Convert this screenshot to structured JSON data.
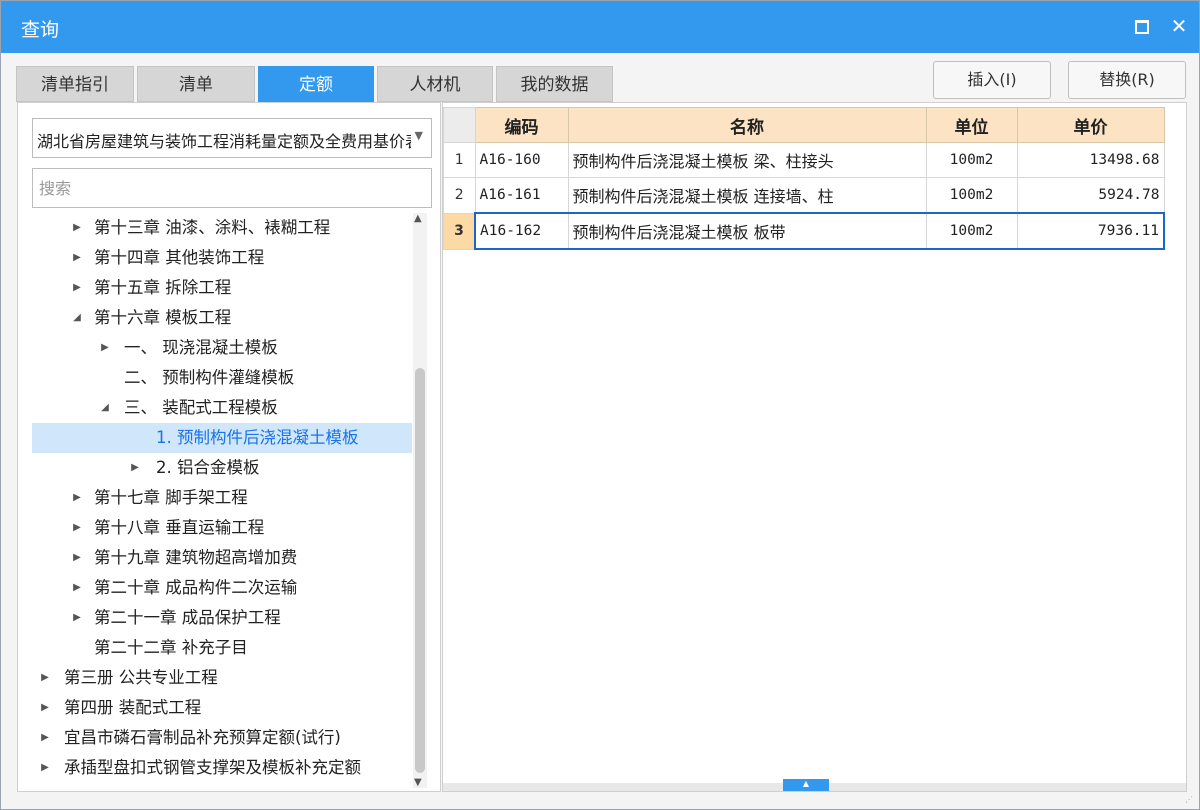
{
  "window": {
    "title": "查询",
    "maximize_icon": "maximize-icon",
    "close_label": "✕"
  },
  "tabs": [
    {
      "label": "清单指引",
      "active": false
    },
    {
      "label": "清单",
      "active": false
    },
    {
      "label": "定额",
      "active": true
    },
    {
      "label": "人材机",
      "active": false
    },
    {
      "label": "我的数据",
      "active": false
    }
  ],
  "actions": {
    "insert_label": "插入(I)",
    "replace_label": "替换(R)"
  },
  "left": {
    "selector_value": "湖北省房屋建筑与装饰工程消耗量定额及全费用基价表",
    "search_placeholder": "搜索",
    "tree": [
      {
        "label": "第十三章 油漆、涂料、裱糊工程",
        "arrow": "▶"
      },
      {
        "label": "第十四章 其他装饰工程",
        "arrow": "▶"
      },
      {
        "label": "第十五章 拆除工程",
        "arrow": "▶"
      },
      {
        "label": "第十六章 模板工程",
        "arrow": "◢"
      },
      {
        "label": "一、 现浇混凝土模板",
        "arrow": "▶"
      },
      {
        "label": "二、 预制构件灌缝模板",
        "arrow": ""
      },
      {
        "label": "三、 装配式工程模板",
        "arrow": "◢"
      },
      {
        "label": "1. 预制构件后浇混凝土模板",
        "arrow": "",
        "selected": true
      },
      {
        "label": "2. 铝合金模板",
        "arrow": "▶"
      },
      {
        "label": "第十七章 脚手架工程",
        "arrow": "▶"
      },
      {
        "label": "第十八章 垂直运输工程",
        "arrow": "▶"
      },
      {
        "label": "第十九章 建筑物超高增加费",
        "arrow": "▶"
      },
      {
        "label": "第二十章 成品构件二次运输",
        "arrow": "▶"
      },
      {
        "label": "第二十一章 成品保护工程",
        "arrow": "▶"
      },
      {
        "label": "第二十二章 补充子目",
        "arrow": ""
      },
      {
        "label": "第三册 公共专业工程",
        "arrow": "▶"
      },
      {
        "label": "第四册 装配式工程",
        "arrow": "▶"
      },
      {
        "label": "宜昌市磷石膏制品补充预算定额(试行)",
        "arrow": "▶"
      },
      {
        "label": "承插型盘扣式钢管支撑架及模板补充定额",
        "arrow": "▶"
      }
    ]
  },
  "table": {
    "headers": {
      "code": "编码",
      "name": "名称",
      "unit": "单位",
      "price": "单价"
    },
    "rows": [
      {
        "num": "1",
        "code": "A16-160",
        "name": "预制构件后浇混凝土模板 梁、柱接头",
        "unit": "100m2",
        "price": "13498.68"
      },
      {
        "num": "2",
        "code": "A16-161",
        "name": "预制构件后浇混凝土模板 连接墙、柱",
        "unit": "100m2",
        "price": "5924.78"
      },
      {
        "num": "3",
        "code": "A16-162",
        "name": "预制构件后浇混凝土模板 板带",
        "unit": "100m2",
        "price": "7936.11",
        "selected": true
      }
    ]
  }
}
